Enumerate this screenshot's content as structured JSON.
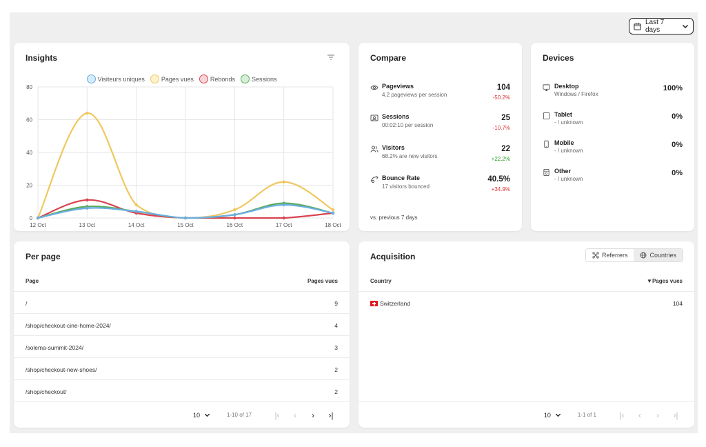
{
  "header": {
    "date_range_label": "Last 7 days",
    "calendar_icon": "calendar-icon",
    "chevron_icon": "chevron-down-icon"
  },
  "insights": {
    "title": "Insights",
    "legend": [
      {
        "label": "Visiteurs uniques",
        "color": "#6aaee0",
        "fill": "#d6ecf9"
      },
      {
        "label": "Pages vues",
        "color": "#f0c75e",
        "fill": "#fdf1cf"
      },
      {
        "label": "Rebonds",
        "color": "#d9434f",
        "fill": "#f8d5d8"
      },
      {
        "label": "Sessions",
        "color": "#5bab5f",
        "fill": "#d8eed8"
      }
    ]
  },
  "chart_data": {
    "type": "line",
    "categories": [
      "12 Oct",
      "13 Oct",
      "14 Oct",
      "15 Oct",
      "16 Oct",
      "17 Oct",
      "18 Oct"
    ],
    "ylim": [
      0,
      80
    ],
    "yticks": [
      0,
      20,
      40,
      60,
      80
    ],
    "grid": true,
    "legend_position": "top",
    "series": [
      {
        "name": "Visiteurs uniques",
        "color": "#6aaee0",
        "values": [
          0,
          6,
          4,
          0,
          2,
          8,
          3
        ]
      },
      {
        "name": "Pages vues",
        "color": "#f0c75e",
        "values": [
          0,
          64,
          8,
          0,
          5,
          22,
          5
        ]
      },
      {
        "name": "Rebonds",
        "color": "#d9434f",
        "values": [
          0,
          11,
          3,
          0,
          0,
          0,
          3
        ]
      },
      {
        "name": "Sessions",
        "color": "#5bab5f",
        "values": [
          0,
          7,
          4,
          0,
          2,
          9,
          3
        ]
      }
    ]
  },
  "compare": {
    "title": "Compare",
    "rows": [
      {
        "icon": "eye-icon",
        "label": "Pageviews",
        "sub": "4.2 pageviews per session",
        "value": "104",
        "delta": "-50.2%",
        "trend": "neg"
      },
      {
        "icon": "sessions-icon",
        "label": "Sessions",
        "sub": "00:02:10 per session",
        "value": "25",
        "delta": "-10.7%",
        "trend": "neg"
      },
      {
        "icon": "users-icon",
        "label": "Visitors",
        "sub": "68.2% are new visitors",
        "value": "22",
        "delta": "+22.2%",
        "trend": "pos"
      },
      {
        "icon": "bounce-icon",
        "label": "Bounce Rate",
        "sub": "17 visitors bounced",
        "value": "40.5%",
        "delta": "+34.9%",
        "trend": "neg"
      }
    ],
    "footer": "vs. previous 7 days"
  },
  "devices": {
    "title": "Devices",
    "rows": [
      {
        "icon": "desktop-icon",
        "label": "Desktop",
        "sub": "Windows / Firefox",
        "value": "100%"
      },
      {
        "icon": "tablet-icon",
        "label": "Tablet",
        "sub": "- / unknown",
        "value": "0%"
      },
      {
        "icon": "mobile-icon",
        "label": "Mobile",
        "sub": "- / unknown",
        "value": "0%"
      },
      {
        "icon": "other-device-icon",
        "label": "Other",
        "sub": "- / unknown",
        "value": "0%"
      }
    ]
  },
  "per_page": {
    "title": "Per page",
    "col_page": "Page",
    "col_views": "Pages vues",
    "rows": [
      {
        "page": "/",
        "views": "9"
      },
      {
        "page": "/shop/checkout-cine-home-2024/",
        "views": "4"
      },
      {
        "page": "/solema-summit-2024/",
        "views": "3"
      },
      {
        "page": "/shop/checkout-new-shoes/",
        "views": "2"
      },
      {
        "page": "/shop/checkout/",
        "views": "2"
      }
    ],
    "pager": {
      "size": "10",
      "range": "1-10 of 17"
    }
  },
  "acquisition": {
    "title": "Acquisition",
    "tabs": [
      {
        "label": "Referrers",
        "active": false
      },
      {
        "label": "Countries",
        "active": true
      }
    ],
    "col_country": "Country",
    "col_views": "▼Pages vues",
    "rows": [
      {
        "country": "Switzerland",
        "views": "104"
      }
    ],
    "pager": {
      "size": "10",
      "range": "1-1 of 1"
    }
  }
}
